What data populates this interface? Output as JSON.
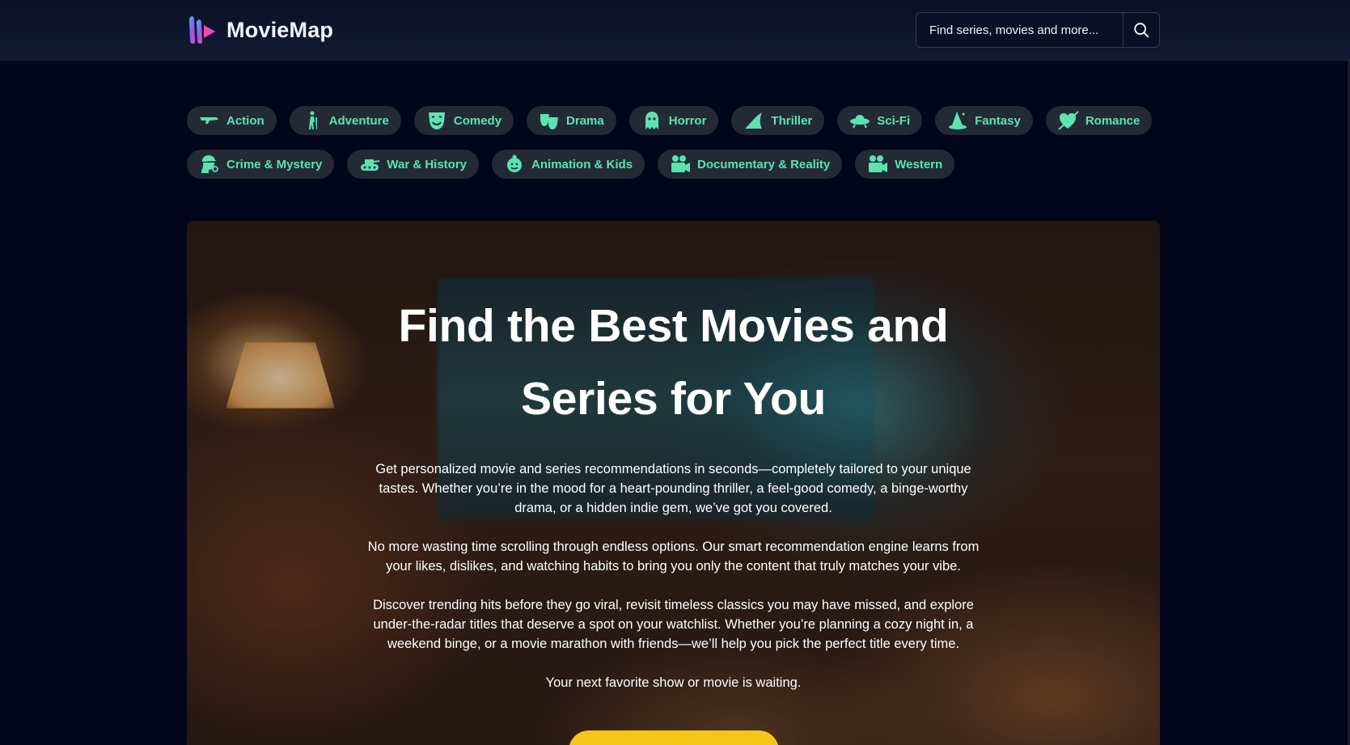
{
  "brand": {
    "name": "MovieMap",
    "accent": "#5be3b0",
    "cta_color": "#f5c518"
  },
  "search": {
    "placeholder": "Find series, movies and more...",
    "icon": "search-icon"
  },
  "genres": {
    "row1": [
      {
        "label": "Action",
        "icon": "gun-icon"
      },
      {
        "label": "Adventure",
        "icon": "hiker-icon"
      },
      {
        "label": "Comedy",
        "icon": "comedy-mask-icon"
      },
      {
        "label": "Drama",
        "icon": "theater-masks-icon"
      },
      {
        "label": "Horror",
        "icon": "ghost-icon"
      },
      {
        "label": "Thriller",
        "icon": "shark-fin-icon"
      },
      {
        "label": "Sci-Fi",
        "icon": "ufo-icon"
      },
      {
        "label": "Fantasy",
        "icon": "wizard-hat-icon"
      },
      {
        "label": "Romance",
        "icon": "heart-arrow-icon"
      }
    ],
    "row2": [
      {
        "label": "Crime & Mystery",
        "icon": "detective-icon"
      },
      {
        "label": "War & History",
        "icon": "tank-icon"
      },
      {
        "label": "Animation & Kids",
        "icon": "child-face-icon"
      },
      {
        "label": "Documentary & Reality",
        "icon": "film-camera-icon"
      },
      {
        "label": "Western",
        "icon": "film-camera-icon"
      }
    ]
  },
  "hero": {
    "title": "Find the Best Movies and Series for You",
    "paragraphs": [
      "Get personalized movie and series recommendations in seconds—completely tailored to your unique tastes. Whether you’re in the mood for a heart-pounding thriller, a feel-good comedy, a binge-worthy drama, or a hidden indie gem, we’ve got you covered.",
      "No more wasting time scrolling through endless options. Our smart recommendation engine learns from your likes, dislikes, and watching habits to bring you only the content that truly matches your vibe.",
      "Discover trending hits before they go viral, revisit timeless classics you may have missed, and explore under-the-radar titles that deserve a spot on your watchlist. Whether you’re planning a cozy night in, a weekend binge, or a movie marathon with friends—we’ll help you pick the perfect title every time.",
      "Your next favorite show or movie is waiting."
    ]
  }
}
